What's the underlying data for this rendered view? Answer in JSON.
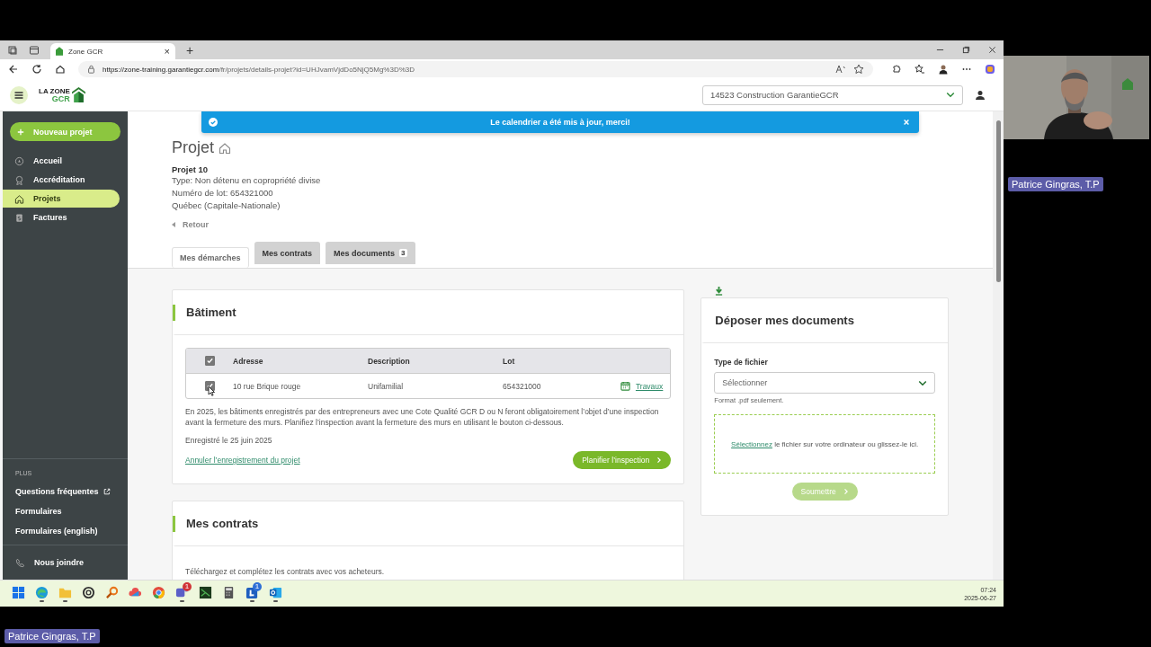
{
  "browser": {
    "tab_title": "Zone GCR",
    "tab_close": "×",
    "new_tab": "+",
    "url_host": "https://zone-training.garantiegcr.com",
    "url_path": "/fr/projets/details-projet?id=UHJvamVjdDo5NjQ5Mg%3D%3D"
  },
  "header": {
    "logo_line1": "LA ZONE",
    "logo_line2": "GCR",
    "account": "14523 Construction GarantieGCR"
  },
  "sidebar": {
    "new_button": "Nouveau projet",
    "items": [
      {
        "label": "Accueil",
        "kind": "home",
        "selected": false
      },
      {
        "label": "Accréditation",
        "kind": "award",
        "selected": false
      },
      {
        "label": "Projets",
        "kind": "house",
        "selected": true
      },
      {
        "label": "Factures",
        "kind": "invoice",
        "selected": false
      }
    ],
    "plus_heading": "PLUS",
    "links": [
      {
        "label": "Questions fréquentes",
        "external": true
      },
      {
        "label": "Formulaires",
        "external": false
      },
      {
        "label": "Formulaires (english)",
        "external": false
      }
    ],
    "contact": "Nous joindre"
  },
  "notice": "Le calendrier a été mis à jour, merci!",
  "project": {
    "title": "Projet",
    "name": "Projet 10",
    "details": [
      "Type: Non détenu en copropriété divise",
      "Numéro de lot: 654321000",
      "Québec (Capitale-Nationale)"
    ],
    "back": "Retour"
  },
  "tabs": [
    {
      "label": "Mes démarches",
      "selected": true
    },
    {
      "label": "Mes contrats",
      "selected": false
    },
    {
      "label": "Mes documents",
      "badge": "3",
      "selected": false
    }
  ],
  "building": {
    "title": "Bâtiment",
    "header_checked": true,
    "columns": [
      "Adresse",
      "Description",
      "Lot"
    ],
    "rows": [
      {
        "checked": true,
        "address": "10 rue Brique rouge",
        "description": "Unifamilial",
        "lot": "654321000",
        "action": "Travaux"
      }
    ],
    "notice": "En 2025, les bâtiments enregistrés par des entrepreneurs avec une Cote Qualité GCR D ou N feront obligatoirement l’objet d’une inspection avant la fermeture des murs. Planifiez l’inspection avant la fermeture des murs en utilisant le bouton ci-dessous.",
    "registered": "Enregistré le 25 juin 2025",
    "cancel_link": "Annuler l’enregistrement du projet",
    "plan_button": "Planifier l’inspection"
  },
  "contracts": {
    "title": "Mes contrats",
    "text": "Téléchargez et complétez les contrats avec vos acheteurs."
  },
  "upload": {
    "title": "Déposer mes documents",
    "field_label": "Type de fichier",
    "placeholder": "Sélectionner",
    "hint": "Format .pdf seulement.",
    "drop_link": "Sélectionnez",
    "drop_text": "le fichier sur votre ordinateur ou glissez-le ici.",
    "submit": "Soumettre",
    "submit_disabled": true
  },
  "taskbar": {
    "time": "07:24",
    "date": "2025-06-27",
    "apps": [
      {
        "kind": "windows",
        "running": false
      },
      {
        "kind": "edge",
        "running": true
      },
      {
        "kind": "folder",
        "running": true
      },
      {
        "kind": "ring",
        "running": false
      },
      {
        "kind": "magnifier",
        "running": false
      },
      {
        "kind": "cloud",
        "running": false
      },
      {
        "kind": "chrome",
        "running": false
      },
      {
        "kind": "teams",
        "running": true,
        "badge": "1"
      },
      {
        "kind": "terminal",
        "running": false
      },
      {
        "kind": "calculator",
        "running": false
      },
      {
        "kind": "blue-square",
        "running": true,
        "badge": "1"
      },
      {
        "kind": "outlook",
        "running": true
      }
    ]
  },
  "video_tile": {
    "name": "Patrice Gingras, T.P"
  },
  "presenter": {
    "name": "Patrice Gingras, T.P"
  }
}
